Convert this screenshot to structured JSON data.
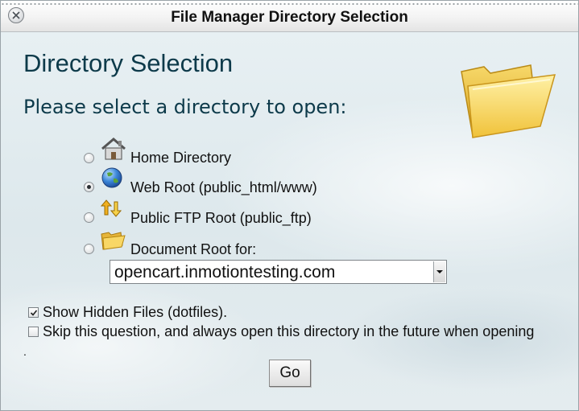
{
  "window": {
    "title": "File Manager Directory Selection"
  },
  "main": {
    "heading": "Directory Selection",
    "subheading": "Please select a directory to open:"
  },
  "options": [
    {
      "label": "Home Directory",
      "icon": "house-icon",
      "selected": false
    },
    {
      "label": "Web Root (public_html/www)",
      "icon": "globe-icon",
      "selected": true
    },
    {
      "label": "Public FTP Root (public_ftp)",
      "icon": "ftp-arrows-icon",
      "selected": false
    },
    {
      "label": "Document Root for:",
      "icon": "folder-icon",
      "selected": false
    }
  ],
  "document_root_select": {
    "value": "opencart.inmotiontesting.com"
  },
  "checkboxes": [
    {
      "label": "Show Hidden Files (dotfiles).",
      "checked": true
    },
    {
      "label": "Skip this question, and always open this directory in the future when opening",
      "checked": false
    }
  ],
  "trailing_text": ".",
  "go_button": {
    "label": "Go"
  },
  "colors": {
    "heading": "#0d3a4a",
    "folder": "#f2c94c"
  }
}
